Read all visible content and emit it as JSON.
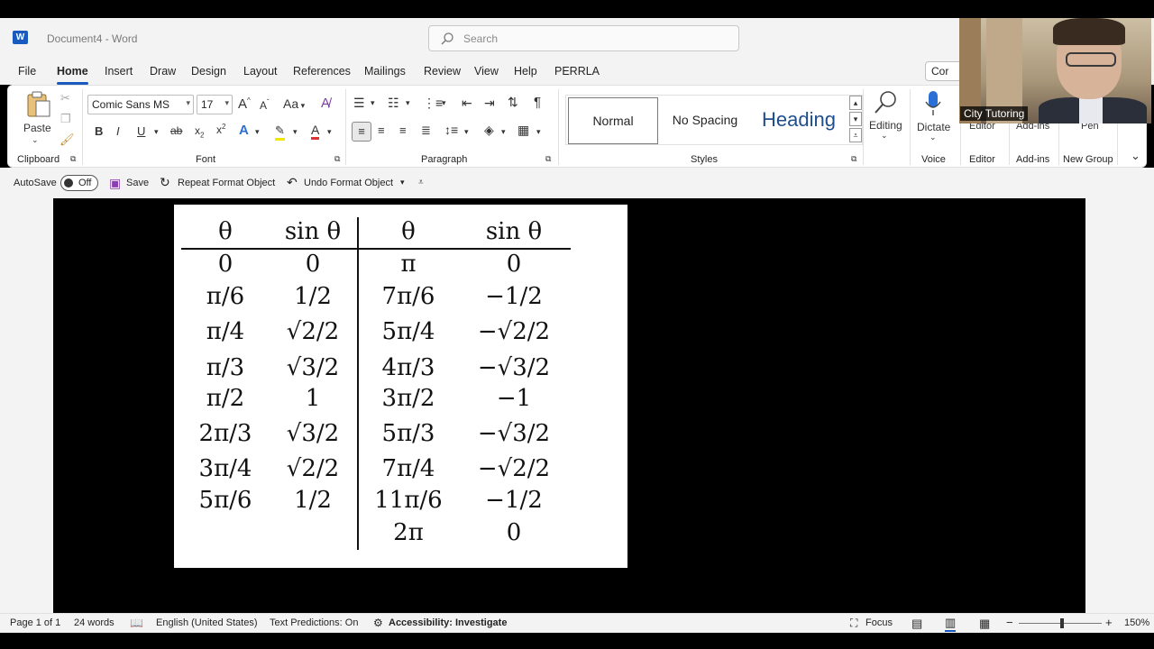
{
  "window": {
    "title": "Document4 - Word",
    "app_icon": "word-icon"
  },
  "search": {
    "placeholder": "Search"
  },
  "comments_label": "Cor",
  "tabs": [
    "File",
    "Home",
    "Insert",
    "Draw",
    "Design",
    "Layout",
    "References",
    "Mailings",
    "Review",
    "View",
    "Help",
    "PERRLA"
  ],
  "active_tab": "Home",
  "ribbon": {
    "clipboard": {
      "paste": "Paste",
      "label": "Clipboard"
    },
    "font": {
      "family": "Comic Sans MS",
      "size": "17",
      "label": "Font",
      "aa_label": "Aa",
      "grow": "A",
      "shrink": "A"
    },
    "paragraph": {
      "label": "Paragraph"
    },
    "styles": {
      "items": [
        "Normal",
        "No Spacing",
        "Heading"
      ],
      "selected": "Normal",
      "label": "Styles"
    },
    "editing": {
      "label": "Editing"
    },
    "voice": {
      "button": "Dictate",
      "label": "Voice"
    },
    "editor": {
      "button": "Editor",
      "label": "Editor"
    },
    "addins": {
      "button": "Add-ins",
      "label": "Add-ins"
    },
    "newgroup": {
      "button": "Pen",
      "label": "New Group"
    }
  },
  "qat": {
    "autosave": "AutoSave",
    "toggle": "Off",
    "save": "Save",
    "repeat": "Repeat Format Object",
    "undo": "Undo Format Object"
  },
  "table": {
    "headers": [
      "θ",
      "sin θ",
      "θ",
      "sin θ"
    ],
    "rows": [
      [
        "0",
        "0",
        "π",
        "0"
      ],
      [
        "π/6",
        "1/2",
        "7π/6",
        "−1/2"
      ],
      [
        "π/4",
        "√2/2",
        "5π/4",
        "−√2/2"
      ],
      [
        "π/3",
        "√3/2",
        "4π/3",
        "−√3/2"
      ],
      [
        "π/2",
        "1",
        "3π/2",
        "−1"
      ],
      [
        "2π/3",
        "√3/2",
        "5π/3",
        "−√3/2"
      ],
      [
        "3π/4",
        "√2/2",
        "7π/4",
        "−√2/2"
      ],
      [
        "5π/6",
        "1/2",
        "11π/6",
        "−1/2"
      ],
      [
        "",
        "",
        "2π",
        "0"
      ]
    ]
  },
  "status": {
    "page": "Page 1 of 1",
    "words": "24 words",
    "language": "English (United States)",
    "predictions": "Text Predictions: On",
    "accessibility": "Accessibility: Investigate",
    "focus": "Focus",
    "zoom": "150%",
    "zoom_level": 0.5
  },
  "webcam": {
    "caption": "City Tutoring"
  }
}
